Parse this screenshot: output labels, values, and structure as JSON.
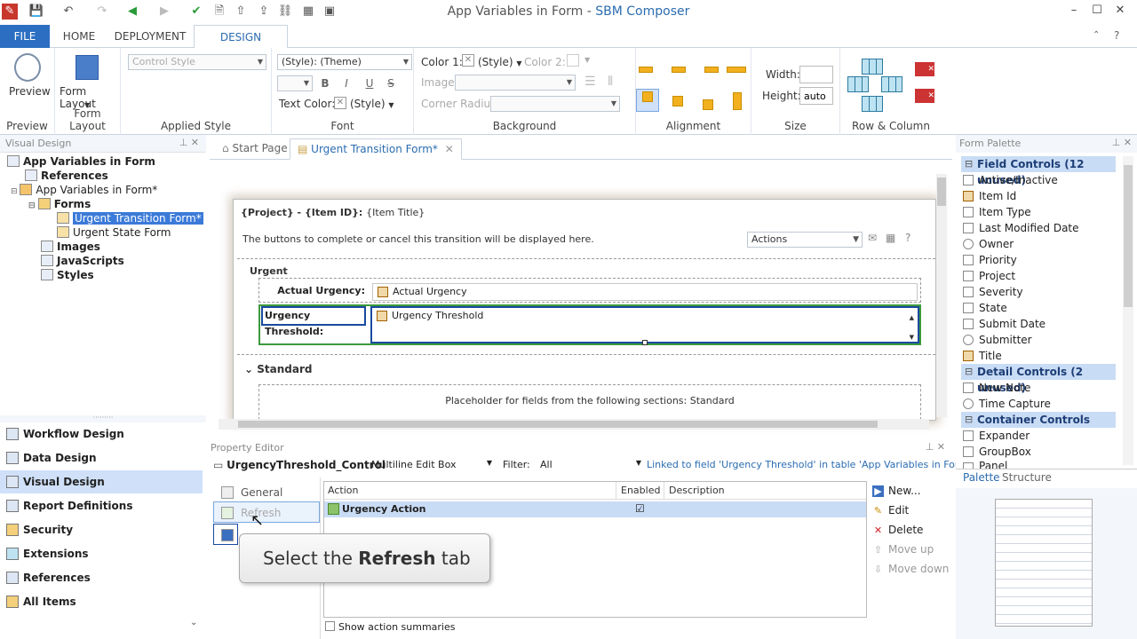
{
  "window": {
    "title_doc": "App Variables in Form",
    "title_sep": " - ",
    "title_app": "SBM Composer"
  },
  "ribbon_tabs": [
    "FILE",
    "HOME",
    "DEPLOYMENT",
    "DESIGN"
  ],
  "ribbon": {
    "preview": {
      "label": "Preview",
      "group": "Preview"
    },
    "form_layout": {
      "label": "Form Layout",
      "group": "Form Layout"
    },
    "applied_style": {
      "control_style": "Control Style",
      "group": "Applied Style"
    },
    "font": {
      "style_value": "(Style): (Theme)",
      "bold": "B",
      "italic": "I",
      "underline": "U",
      "strike": "S",
      "text_color_label": "Text Color:",
      "text_color_value": "(Style)",
      "group": "Font"
    },
    "background": {
      "color1_label": "Color 1:",
      "color1_value": "(Style)",
      "color2_label": "Color 2:",
      "image_label": "Image:",
      "corner_radius_label": "Corner Radius:",
      "group": "Background"
    },
    "alignment": {
      "group": "Alignment"
    },
    "size": {
      "width_label": "Width:",
      "width_value": "",
      "height_label": "Height:",
      "height_value": "auto",
      "group": "Size"
    },
    "row_column": {
      "group": "Row & Column"
    }
  },
  "visual_design": {
    "title": "Visual Design",
    "tree": [
      {
        "label": "App Variables in Form",
        "bold": true
      },
      {
        "label": "References",
        "bold": true
      },
      {
        "label": "App Variables in Form*",
        "bold": false
      },
      {
        "label": "Forms",
        "bold": true
      },
      {
        "label": "Urgent Transition Form*",
        "bold": false,
        "selected": true
      },
      {
        "label": "Urgent State Form",
        "bold": false
      },
      {
        "label": "Images",
        "bold": true
      },
      {
        "label": "JavaScripts",
        "bold": true
      },
      {
        "label": "Styles",
        "bold": true
      }
    ]
  },
  "nav": [
    "Workflow Design",
    "Data Design",
    "Visual Design",
    "Report Definitions",
    "Security",
    "Extensions",
    "References",
    "All Items"
  ],
  "doc_tabs": {
    "start": "Start Page",
    "form": "Urgent Transition Form*"
  },
  "form": {
    "header": "{Project} - {Item ID}:",
    "header_title": "{Item Title}",
    "buttons_note": "The buttons to complete or cancel this transition will be displayed here.",
    "actions_value": "Actions",
    "section_urgent": "Urgent",
    "actual_urgency_label": "Actual Urgency:",
    "actual_urgency_field": "Actual Urgency",
    "urgency_threshold_label": "Urgency Threshold:",
    "urgency_threshold_field": "Urgency Threshold",
    "section_standard": "Standard",
    "placeholder": "Placeholder for fields from the following sections: Standard"
  },
  "property_editor": {
    "title": "Property Editor",
    "control_name": "UrgencyThreshold_Control",
    "control_type": "Multiline Edit Box",
    "filter_label": "Filter:",
    "filter_value": "All",
    "linked_note": "Linked to field 'Urgency Threshold' in table 'App Variables in Form'.",
    "tabs": [
      "General",
      "Refresh"
    ],
    "columns": {
      "action": "Action",
      "enabled": "Enabled",
      "description": "Description"
    },
    "row": {
      "action": "Urgency Action",
      "enabled": "☑",
      "description": ""
    },
    "buttons": [
      "New...",
      "Edit",
      "Delete",
      "Move up",
      "Move down"
    ],
    "show_summaries": "Show action summaries"
  },
  "palette": {
    "title": "Form Palette",
    "cat_field": "Field Controls (12 unused)",
    "field_items": [
      "Active/Inactive",
      "Item Id",
      "Item Type",
      "Last Modified Date",
      "Owner",
      "Priority",
      "Project",
      "Severity",
      "State",
      "Submit Date",
      "Submitter",
      "Title"
    ],
    "cat_detail": "Detail Controls (2 unused)",
    "detail_items": [
      "New Note",
      "Time Capture"
    ],
    "cat_container": "Container Controls",
    "container_items": [
      "Expander",
      "GroupBox",
      "Panel"
    ],
    "tab_palette": "Palette",
    "tab_structure": "Structure"
  },
  "tooltip": {
    "prefix": "Select the ",
    "bold": "Refresh",
    "suffix": " tab"
  },
  "colors": {
    "accent": "#2c6fc2",
    "selection": "#3b7ad8",
    "highlight": "#c9dcf5",
    "alignment_icon": "#f2b01e"
  }
}
